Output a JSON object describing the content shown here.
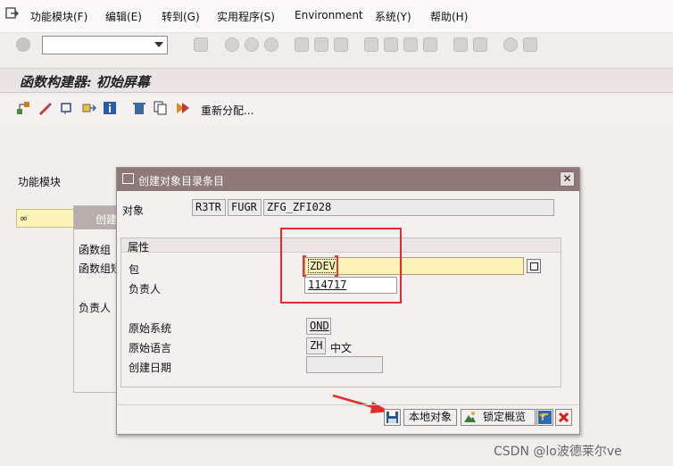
{
  "menubar": {
    "items": [
      "功能模块(F)",
      "编辑(E)",
      "转到(G)",
      "实用程序(S)",
      "Environment",
      "系统(Y)",
      "帮助(H)"
    ]
  },
  "toolbar": {
    "command_field": {
      "value": "",
      "placeholder": ""
    }
  },
  "screen": {
    "title": "函数构建器: 初始屏幕",
    "app_toolbar": {
      "reassign_label": "重新分配..."
    },
    "function_module_label": "功能模块",
    "bg_popup": {
      "title": "创建",
      "labels": [
        "函数组",
        "函数组短",
        "负责人"
      ]
    }
  },
  "dialog": {
    "title": "创建对象目录条目",
    "object_label": "对象",
    "object_fields": [
      "R3TR",
      "FUGR",
      "ZFG_ZFI028"
    ],
    "attributes": {
      "header": "属性",
      "package_label": "包",
      "package_value": "ZDEV",
      "owner_label": "负责人",
      "owner_value": "114717",
      "original_system_label": "原始系统",
      "original_system_value": "OND",
      "original_language_label": "原始语言",
      "original_language_code": "ZH",
      "original_language_name": "中文",
      "created_on_label": "创建日期",
      "created_on_value": ""
    },
    "buttons": {
      "local_object": "本地对象",
      "lock_overview": "锁定概览"
    }
  },
  "watermark": "CSDN @lo波德莱尔ve",
  "colors": {
    "dialog_header": "#8e7878",
    "required_input": "#fdf2b7",
    "annotation_red": "#e22b2b"
  }
}
